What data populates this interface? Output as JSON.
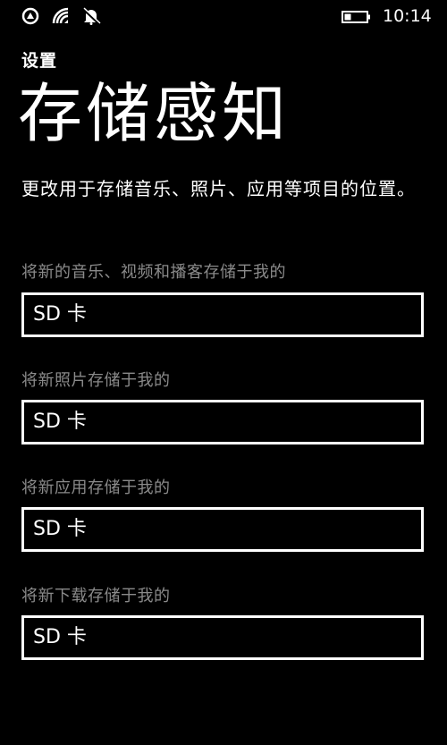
{
  "status_bar": {
    "icons": [
      "cellular-signal-icon",
      "wifi-icon",
      "quiet-hours-bell-icon",
      "battery-icon"
    ],
    "time": "10:14"
  },
  "header": {
    "app_title": "设置",
    "page_title": "存储感知"
  },
  "description": "更改用于存储音乐、照片、应用等项目的位置。",
  "settings": [
    {
      "label": "将新的音乐、视频和播客存储于我的",
      "value": "SD 卡"
    },
    {
      "label": "将新照片存储于我的",
      "value": "SD 卡"
    },
    {
      "label": "将新应用存储于我的",
      "value": "SD 卡"
    },
    {
      "label": "将新下载存储于我的",
      "value": "SD 卡"
    }
  ],
  "colors": {
    "background": "#000000",
    "text": "#ffffff",
    "label": "#8a8a8a"
  }
}
